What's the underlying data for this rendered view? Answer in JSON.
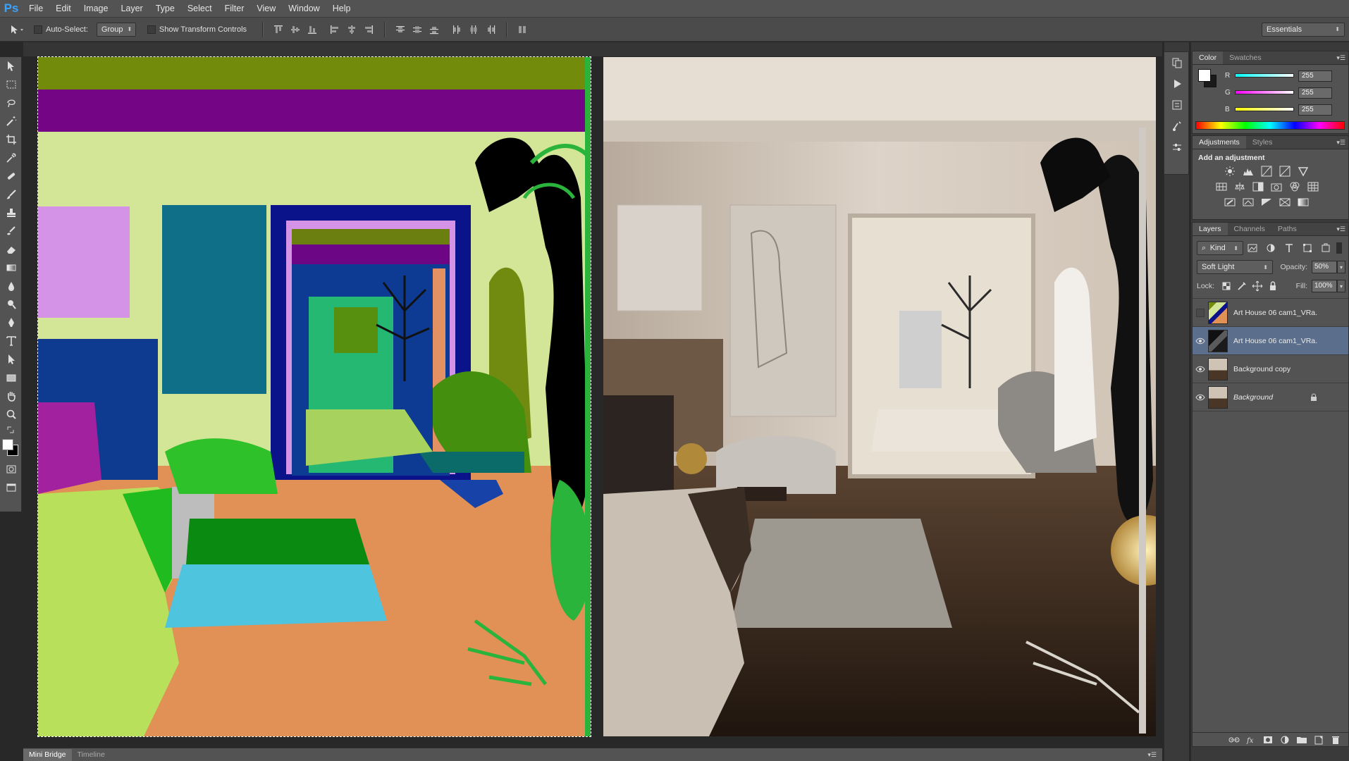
{
  "app": {
    "logo": "Ps"
  },
  "menu": [
    "File",
    "Edit",
    "Image",
    "Layer",
    "Type",
    "Select",
    "Filter",
    "View",
    "Window",
    "Help"
  ],
  "options": {
    "auto_select_label": "Auto-Select:",
    "auto_select_value": "Group",
    "show_transform_label": "Show Transform Controls",
    "workspace": "Essentials"
  },
  "color_panel": {
    "tabs": [
      "Color",
      "Swatches"
    ],
    "channels": [
      {
        "label": "R",
        "value": "255"
      },
      {
        "label": "G",
        "value": "255"
      },
      {
        "label": "B",
        "value": "255"
      }
    ],
    "foreground": "#ffffff"
  },
  "adjustments_panel": {
    "tabs": [
      "Adjustments",
      "Styles"
    ],
    "heading": "Add an adjustment"
  },
  "layers_panel": {
    "tabs": [
      "Layers",
      "Channels",
      "Paths"
    ],
    "filter_kind": "Kind",
    "blend_mode": "Soft Light",
    "opacity_label": "Opacity:",
    "opacity_value": "50%",
    "lock_label": "Lock:",
    "fill_label": "Fill:",
    "fill_value": "100%",
    "layers": [
      {
        "name": "Art House 06 cam1_VRa...",
        "visible": false,
        "selected": false
      },
      {
        "name": "Art House 06 cam1_VRa...",
        "visible": true,
        "selected": true
      },
      {
        "name": "Background copy",
        "visible": true,
        "selected": false
      },
      {
        "name": "Background",
        "visible": true,
        "selected": false,
        "locked": true
      }
    ]
  },
  "bottom_tabs": [
    "Mini Bridge",
    "Timeline"
  ],
  "colors": {
    "accent": "#3aa3ff",
    "panel": "#535353",
    "selection": "#5b6f8c"
  }
}
